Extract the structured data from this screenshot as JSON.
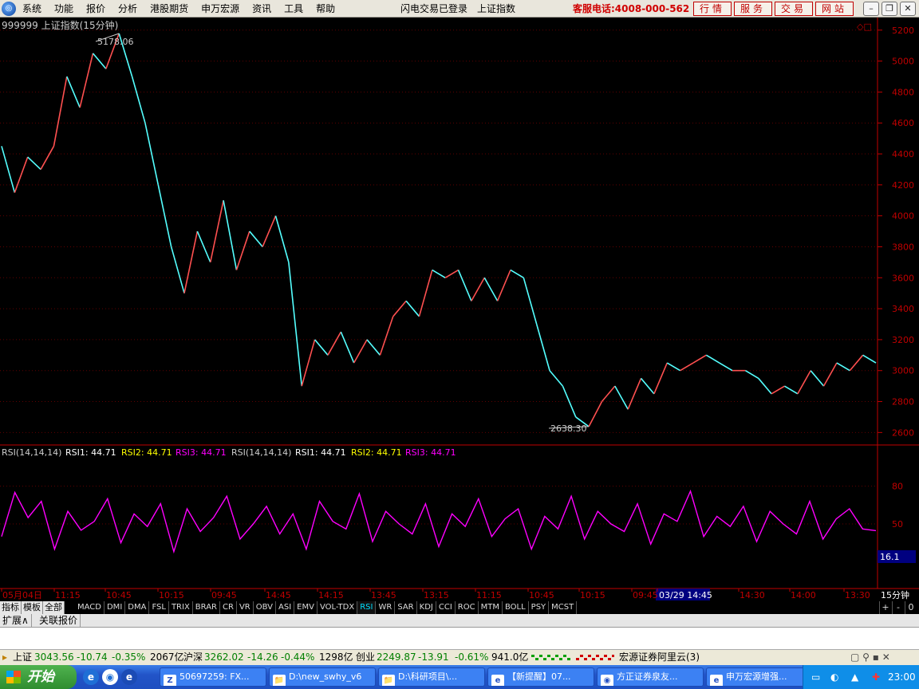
{
  "menubar": {
    "logo_glyph": "◎",
    "items": [
      "系统",
      "功能",
      "报价",
      "分析",
      "港股期货",
      "申万宏源",
      "资讯",
      "工具",
      "帮助"
    ],
    "status_text": "闪电交易已登录",
    "index_name": "上证指数",
    "hotline": "客服电话:4008-000-562",
    "buttons": [
      "行情",
      "服务",
      "交易",
      "网站"
    ]
  },
  "window_controls": {
    "minimize": "–",
    "restore": "❐",
    "close": "✕"
  },
  "chart": {
    "title": "999999 上证指数(15分钟)",
    "high_label": "5178.06",
    "low_label": "2638.30",
    "corner_icons": "◇□",
    "rsi_label": "RSI(14,14,14)",
    "rsi_values": [
      {
        "name": "RSI1: 44.71",
        "color": "#ffffff"
      },
      {
        "name": "RSI2: 44.71",
        "color": "#ffff00"
      },
      {
        "name": "RSI3: 44.71",
        "color": "#ff00ff"
      }
    ],
    "rsi_current": "16.1",
    "cursor_label": "03/29 14:45",
    "period": "15分钟"
  },
  "chart_data": [
    {
      "type": "line",
      "title": "999999 上证指数(15分钟)",
      "y_ticks": [
        2600,
        2800,
        3000,
        3200,
        3400,
        3600,
        3800,
        4000,
        4200,
        4400,
        4600,
        4800,
        5000,
        5200
      ],
      "ylim": [
        2540,
        5240
      ],
      "x_tick_labels": [
        "05月04日",
        "11:15",
        "10:45",
        "10:15",
        "09:45",
        "14:45",
        "14:15",
        "13:45",
        "13:15",
        "11:15",
        "10:45",
        "10:15",
        "09:45",
        "03/29 14:45",
        "14:30",
        "14:00",
        "13:30"
      ],
      "annotations": [
        {
          "label": "5178.06",
          "value": 5178.06
        },
        {
          "label": "2638.30",
          "value": 2638.3
        }
      ],
      "series": [
        {
          "values": [
            4450,
            4150,
            4380,
            4300,
            4450,
            4900,
            4700,
            5050,
            4950,
            5178.06,
            4900,
            4600,
            4200,
            3800,
            3500,
            3900,
            3700,
            4100,
            3650,
            3900,
            3800,
            4000,
            3700,
            2900,
            3200,
            3100,
            3250,
            3050,
            3200,
            3100,
            3350,
            3450,
            3350,
            3650,
            3600,
            3650,
            3450,
            3600,
            3450,
            3650,
            3600,
            3300,
            3000,
            2900,
            2700,
            2638.3,
            2800,
            2900,
            2750,
            2950,
            2850,
            3050,
            3000,
            3050,
            3100,
            3050,
            3000,
            3000,
            2950,
            2850,
            2900,
            2850,
            3000,
            2900,
            3050,
            3000,
            3100,
            3050
          ]
        }
      ]
    },
    {
      "type": "line",
      "title": "RSI(14,14,14)",
      "y_ticks": [
        50,
        80
      ],
      "ylim": [
        0,
        100
      ],
      "series": [
        {
          "name": "RSI3: 44.71",
          "values": [
            40,
            75,
            55,
            68,
            30,
            60,
            45,
            52,
            70,
            35,
            58,
            48,
            66,
            28,
            62,
            44,
            55,
            72,
            38,
            50,
            64,
            42,
            58,
            30,
            68,
            52,
            46,
            74,
            36,
            60,
            50,
            42,
            66,
            32,
            58,
            48,
            70,
            40,
            54,
            62,
            30,
            56,
            46,
            72,
            38,
            60,
            50,
            44,
            66,
            34,
            58,
            52,
            76,
            40,
            56,
            48,
            64,
            36,
            60,
            50,
            42,
            68,
            38,
            54,
            62,
            46,
            44.71
          ]
        }
      ]
    }
  ],
  "tabbar": {
    "left": [
      "指标",
      "模板",
      "全部"
    ],
    "indicators": [
      "MACD",
      "DMI",
      "DMA",
      "FSL",
      "TRIX",
      "BRAR",
      "CR",
      "VR",
      "OBV",
      "ASI",
      "EMV",
      "VOL-TDX",
      "RSI",
      "WR",
      "SAR",
      "KDJ",
      "CCI",
      "ROC",
      "MTM",
      "BOLL",
      "PSY",
      "MCST"
    ],
    "active": "RSI",
    "nav_plus": "+",
    "nav_minus": "-",
    "nav_zero": "0"
  },
  "expandbar": {
    "expand": "扩展∧",
    "linked_quote": "关联报价"
  },
  "statusbar": {
    "sh_label": "上证",
    "sh_value": "3043.56",
    "sh_change": "-10.74",
    "sh_pct": "-0.35%",
    "sh_amount": "2067亿",
    "hs_label": "沪深",
    "hs_value": "3262.02",
    "hs_change": "-14.26",
    "hs_pct": "-0.44%",
    "hs_amount": "1298亿",
    "cy_label": "创业",
    "cy_value": "2249.87",
    "cy_change": "-13.91",
    "cy_pct": "-0.61%",
    "cy_amount": "941.0亿",
    "server": "宏源证券阿里云(3)"
  },
  "taskbar": {
    "start": "开始",
    "items": [
      {
        "icon": "Z",
        "label": "50697259: FX..."
      },
      {
        "icon": "📁",
        "label": "D:\\new_swhy_v6"
      },
      {
        "icon": "📁",
        "label": "D:\\科研项目\\..."
      },
      {
        "icon": "e",
        "label": "【新提醒】07..."
      },
      {
        "icon": "◉",
        "label": "方正证券泉友..."
      },
      {
        "icon": "e",
        "label": "申万宏源增强..."
      }
    ],
    "clock": "23:00"
  }
}
